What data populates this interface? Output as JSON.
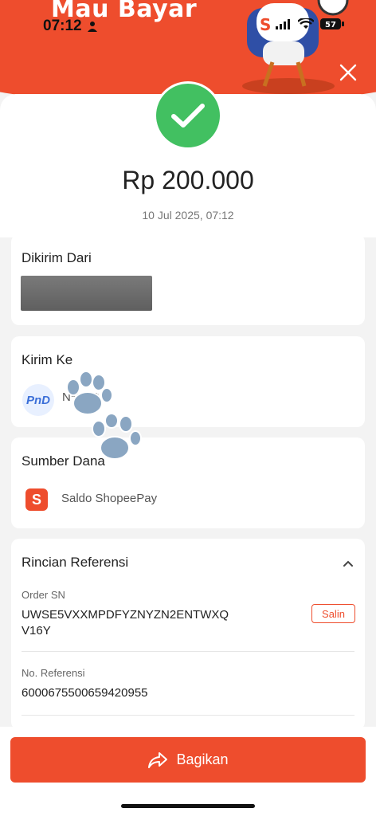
{
  "header": {
    "banner_text": "Mau Bayar",
    "status_time": "07:12",
    "battery": "57"
  },
  "payment": {
    "amount": "Rp 200.000",
    "datetime": "10 Jul 2025, 07:12"
  },
  "sender": {
    "title": "Dikirim Dari"
  },
  "recipient": {
    "title": "Kirim Ke",
    "avatar_text": "PnD",
    "masked_name": "N******"
  },
  "source": {
    "title": "Sumber Dana",
    "method": "Saldo ShopeePay"
  },
  "reference": {
    "title": "Rincian Referensi",
    "order_sn_label": "Order SN",
    "order_sn_line1": "UWSE5VXXMPDFYZNYZN2ENTWXQ",
    "order_sn_line2": "V16Y",
    "copy_label": "Salin",
    "ref_label": "No. Referensi",
    "ref_value": "6000675500659420955"
  },
  "footer": {
    "share_label": "Bagikan"
  },
  "colors": {
    "brand": "#ee4d2d",
    "success": "#42c061"
  }
}
